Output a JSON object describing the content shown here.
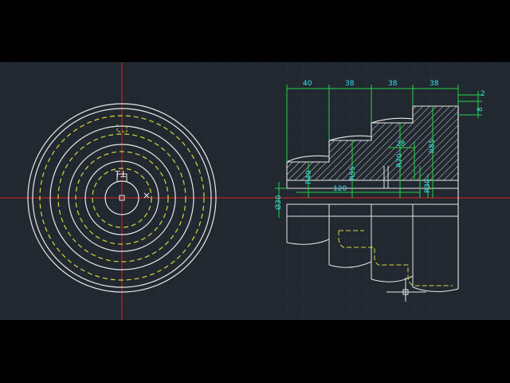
{
  "colors": {
    "background": "#212830",
    "grid": "#2b333d",
    "geometry": "#e8e8e8",
    "hidden_lines": "#d8d63a",
    "dimensions": "#22d24a",
    "dimension_text": "#37e1e8",
    "center_lines": "#e02020"
  },
  "drawing": {
    "top_dimensions": [
      "40",
      "38",
      "38",
      "38"
    ],
    "right_dimensions": [
      "2",
      "8"
    ],
    "inner_dimensions": {
      "d28": "28",
      "d120": "120",
      "dia30": "Ø30",
      "r40": "R40",
      "r55": "R55",
      "r70": "R70",
      "r85": "R85",
      "r30": "R30"
    },
    "key_symbol": "T"
  }
}
